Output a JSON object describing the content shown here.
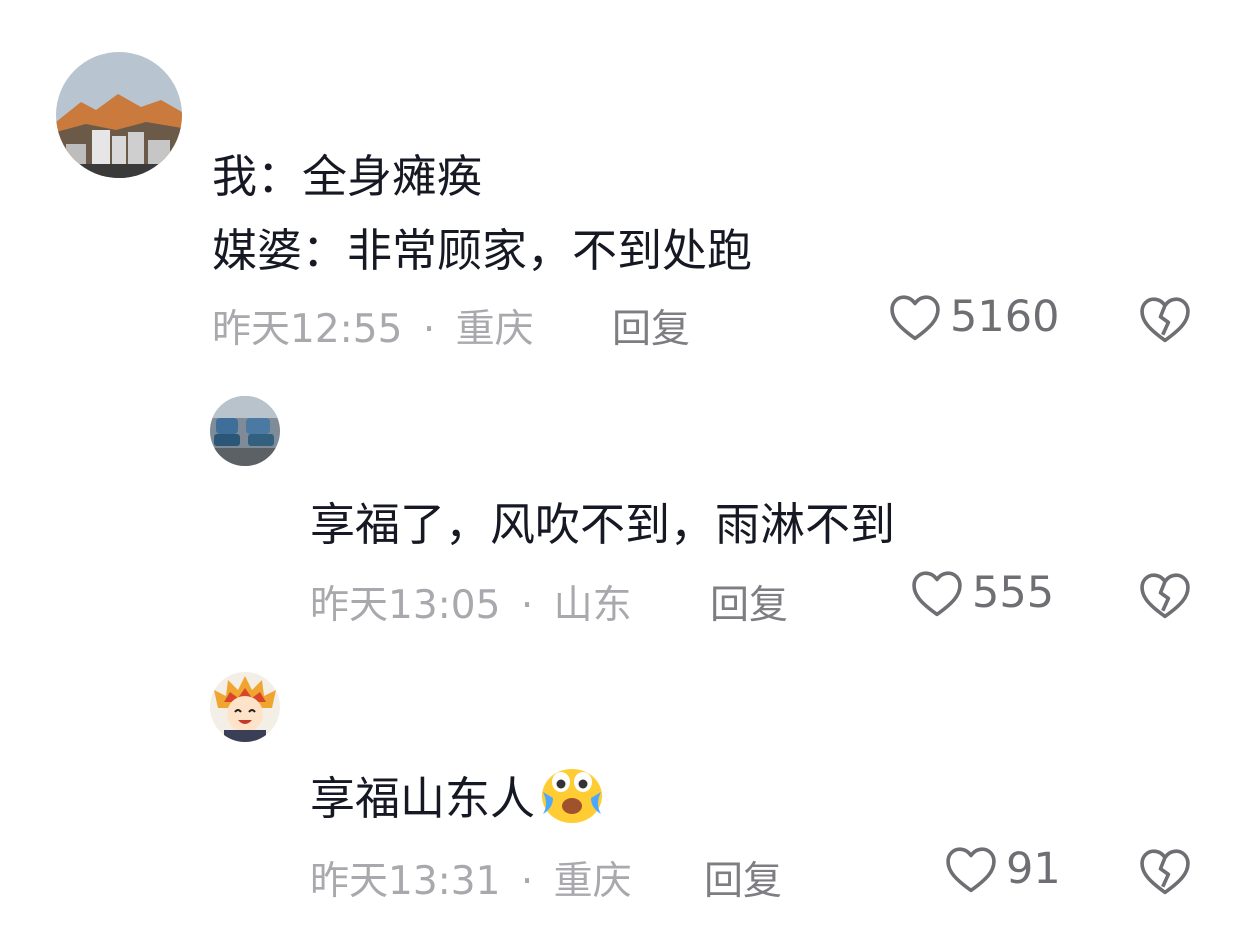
{
  "comments": [
    {
      "lines": [
        "我：全身瘫痪",
        "媒婆：非常顾家，不到处跑"
      ],
      "time": "昨天12:55",
      "separator": "·",
      "location": "重庆",
      "reply_label": "回复",
      "likes": "5160",
      "avatar_icon": "mountain-avatar-icon"
    },
    {
      "lines": [
        "享福了，风吹不到，雨淋不到"
      ],
      "time": "昨天13:05",
      "separator": "·",
      "location": "山东",
      "reply_label": "回复",
      "likes": "555",
      "avatar_icon": "cars-avatar-icon"
    },
    {
      "lines": [
        "享福山东人"
      ],
      "time": "昨天13:31",
      "separator": "·",
      "location": "重庆",
      "reply_label": "回复",
      "likes": "91",
      "avatar_icon": "cartoon-avatar-icon",
      "emoji": "crying-face-emoji"
    }
  ],
  "colors": {
    "text": "#161823",
    "meta": "#a8a8ad",
    "reply": "#7d7d82",
    "icon": "#6e6e73"
  }
}
